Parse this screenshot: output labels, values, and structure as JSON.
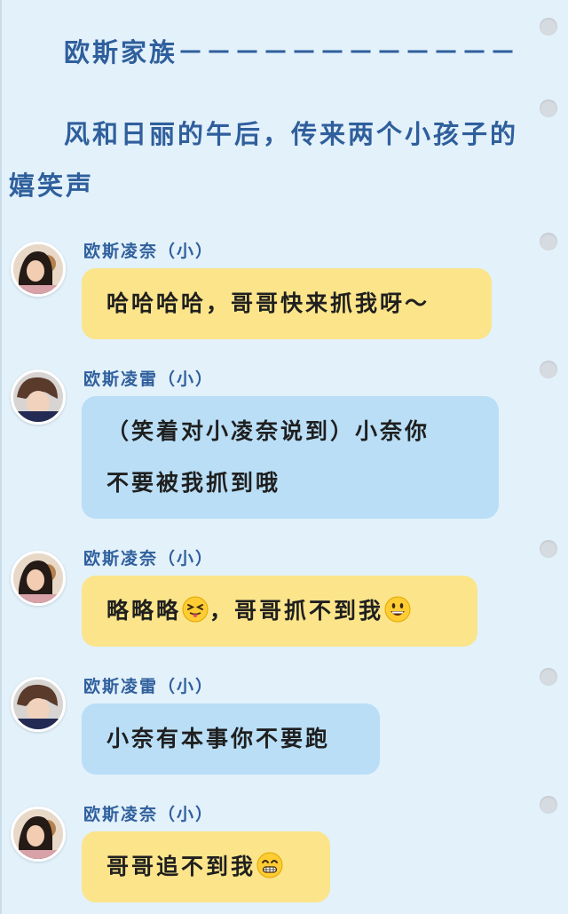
{
  "narration": {
    "line1": "欧斯家族－－－－－－－－－－－－",
    "line2a": "风和日丽的午后，传来两个小孩子的",
    "line2b": "嬉笑声"
  },
  "messages": [
    {
      "speaker": "欧斯凌奈（小）",
      "avatar": "girl-avatar",
      "color": "#fbe48a",
      "lines": [
        "哈哈哈哈，哥哥快来抓我呀～"
      ]
    },
    {
      "speaker": "欧斯凌雷（小）",
      "avatar": "boy-avatar",
      "color": "#b9def6",
      "lines": [
        "（笑着对小凌奈说到）小奈你",
        "不要被我抓到哦"
      ]
    },
    {
      "speaker": "欧斯凌奈（小）",
      "avatar": "girl-avatar",
      "color": "#fbe48a",
      "text_before_emoji": "略略略",
      "emoji_1": "squinting-tongue-emoji",
      "text_middle": "，哥哥抓不到我",
      "emoji_2": "grinning-emoji"
    },
    {
      "speaker": "欧斯凌雷（小）",
      "avatar": "boy-avatar",
      "color": "#b9def6",
      "lines": [
        "小奈有本事你不要跑"
      ]
    },
    {
      "speaker": "欧斯凌奈（小）",
      "avatar": "girl-avatar",
      "color": "#fbe48a",
      "text_before_emoji": "哥哥追不到我",
      "emoji": "beaming-smile-emoji"
    }
  ],
  "colors": {
    "background": "#e3f1fb",
    "title_text": "#2f5f9c",
    "yellow_bubble": "#fbe48a",
    "blue_bubble": "#b9def6"
  }
}
